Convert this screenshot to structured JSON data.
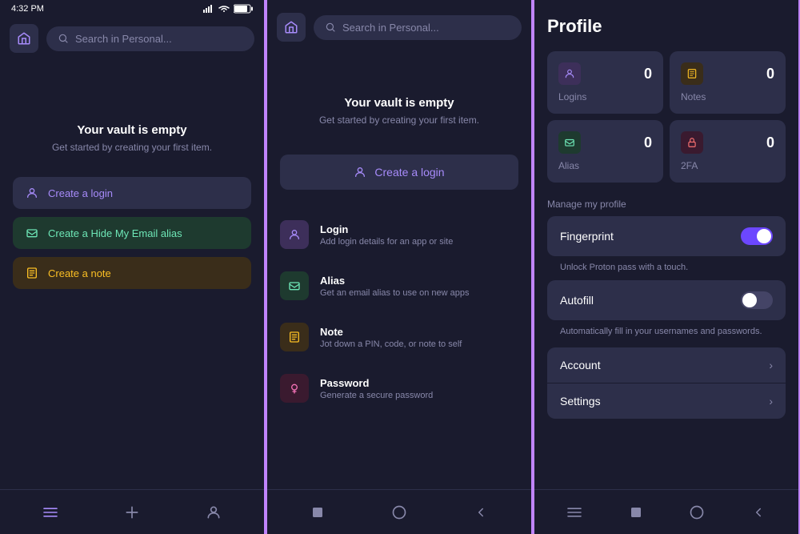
{
  "panel1": {
    "statusBar": {
      "time": "4:32 PM"
    },
    "search": {
      "placeholder": "Search in Personal..."
    },
    "emptyVault": {
      "title": "Your vault is empty",
      "subtitle": "Get started by creating your first item."
    },
    "buttons": {
      "createLogin": "Create a login",
      "createAlias": "Create a Hide My Email alias",
      "createNote": "Create a note"
    },
    "bottomNav": {
      "list": "☰",
      "add": "+",
      "profile": "👤"
    }
  },
  "panel2": {
    "search": {
      "placeholder": "Search in Personal..."
    },
    "emptyVault": {
      "title": "Your vault is empty",
      "subtitle": "Get started by creating your first item."
    },
    "createLogin": "Create a login",
    "menuItems": [
      {
        "title": "Login",
        "description": "Add login details for an app or site",
        "type": "login"
      },
      {
        "title": "Alias",
        "description": "Get an email alias to use on new apps",
        "type": "alias"
      },
      {
        "title": "Note",
        "description": "Jot down a PIN, code, or note to self",
        "type": "note"
      },
      {
        "title": "Password",
        "description": "Generate a secure password",
        "type": "password"
      }
    ]
  },
  "panel3": {
    "title": "Profile",
    "stats": [
      {
        "label": "Logins",
        "count": "0",
        "type": "login"
      },
      {
        "label": "Notes",
        "count": "0",
        "type": "note"
      },
      {
        "label": "Alias",
        "count": "0",
        "type": "alias"
      },
      {
        "label": "2FA",
        "count": "0",
        "type": "2fa"
      }
    ],
    "manageSection": {
      "title": "Manage my profile",
      "fingerprint": {
        "label": "Fingerprint",
        "description": "Unlock Proton pass with a touch.",
        "enabled": true
      },
      "autofill": {
        "label": "Autofill",
        "description": "Automatically fill in your usernames and passwords.",
        "enabled": false
      }
    },
    "navLinks": [
      {
        "label": "Account"
      },
      {
        "label": "Settings"
      }
    ]
  }
}
